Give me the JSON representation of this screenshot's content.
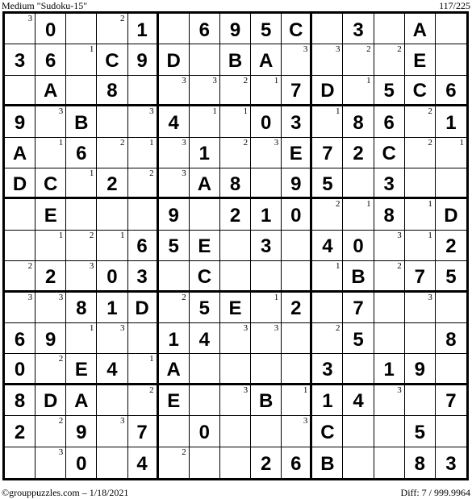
{
  "header": {
    "title": "Medium \"Sudoku-15\"",
    "puzzle_index": "117/225"
  },
  "footer": {
    "credit": "©grouppuzzles.com – 1/18/2021",
    "difficulty": "Diff: 7 / 999.9964"
  },
  "grid": {
    "size": 15,
    "box_cols": 5,
    "box_rows": 3,
    "cells": [
      [
        {
          "h": "3"
        },
        {
          "v": "0"
        },
        {},
        {
          "h": "2"
        },
        {
          "v": "1"
        },
        {},
        {
          "v": "6"
        },
        {
          "v": "9"
        },
        {
          "v": "5"
        },
        {
          "v": "C"
        },
        {},
        {
          "v": "3"
        },
        {},
        {
          "v": "A"
        },
        {}
      ],
      [
        {
          "v": "3"
        },
        {
          "v": "6"
        },
        {
          "h": "1"
        },
        {
          "v": "C"
        },
        {
          "v": "9"
        },
        {
          "v": "D"
        },
        {},
        {
          "v": "B"
        },
        {
          "v": "A"
        },
        {
          "h": "3"
        },
        {
          "h": "3"
        },
        {
          "h": "2"
        },
        {
          "h": "2"
        },
        {
          "v": "E"
        },
        {}
      ],
      [
        {},
        {
          "v": "A"
        },
        {},
        {
          "v": "8"
        },
        {},
        {
          "h": "3"
        },
        {
          "h": "3"
        },
        {
          "h": "2"
        },
        {
          "h": "1"
        },
        {
          "v": "7"
        },
        {
          "v": "D"
        },
        {
          "h": "1"
        },
        {
          "v": "5"
        },
        {
          "v": "C"
        },
        {
          "v": "6"
        }
      ],
      [
        {
          "v": "9"
        },
        {
          "h": "3"
        },
        {
          "v": "B"
        },
        {},
        {
          "h": "3"
        },
        {
          "v": "4"
        },
        {
          "h": "1"
        },
        {
          "h": "1"
        },
        {
          "v": "0"
        },
        {
          "v": "3"
        },
        {
          "h": "1"
        },
        {
          "v": "8"
        },
        {
          "v": "6"
        },
        {
          "h": "2"
        },
        {
          "v": "1"
        }
      ],
      [
        {
          "v": "A"
        },
        {
          "h": "1"
        },
        {
          "v": "6"
        },
        {
          "h": "2"
        },
        {
          "h": "1"
        },
        {
          "h": "3"
        },
        {
          "v": "1"
        },
        {
          "h": "2"
        },
        {
          "h": "3"
        },
        {
          "v": "E"
        },
        {
          "v": "7"
        },
        {
          "v": "2"
        },
        {
          "v": "C"
        },
        {
          "h": "2"
        },
        {
          "h": "1"
        }
      ],
      [
        {
          "v": "D"
        },
        {
          "v": "C"
        },
        {
          "h": "1"
        },
        {
          "v": "2"
        },
        {
          "h": "2"
        },
        {
          "h": "3"
        },
        {
          "v": "A"
        },
        {
          "v": "8"
        },
        {},
        {
          "v": "9"
        },
        {
          "v": "5"
        },
        {},
        {
          "v": "3"
        },
        {},
        {}
      ],
      [
        {},
        {
          "v": "E"
        },
        {},
        {},
        {},
        {
          "v": "9"
        },
        {},
        {
          "v": "2"
        },
        {
          "v": "1"
        },
        {
          "v": "0"
        },
        {
          "h": "2"
        },
        {
          "h": "1"
        },
        {
          "v": "8"
        },
        {
          "h": "1"
        },
        {
          "v": "D"
        }
      ],
      [
        {},
        {
          "h": "1"
        },
        {
          "h": "2"
        },
        {
          "h": "1"
        },
        {
          "v": "6"
        },
        {
          "v": "5"
        },
        {
          "v": "E"
        },
        {},
        {
          "v": "3"
        },
        {},
        {
          "v": "4"
        },
        {
          "v": "0"
        },
        {
          "h": "3"
        },
        {
          "h": "1"
        },
        {
          "v": "2"
        }
      ],
      [
        {
          "h": "2"
        },
        {
          "v": "2"
        },
        {
          "h": "3"
        },
        {
          "v": "0"
        },
        {
          "v": "3"
        },
        {},
        {
          "v": "C"
        },
        {},
        {},
        {},
        {
          "h": "1"
        },
        {
          "v": "B"
        },
        {
          "h": "2"
        },
        {
          "v": "7"
        },
        {
          "v": "5"
        }
      ],
      [
        {
          "h": "3"
        },
        {
          "h": "3"
        },
        {
          "v": "8"
        },
        {
          "v": "1"
        },
        {
          "v": "D"
        },
        {
          "h": "2"
        },
        {
          "v": "5"
        },
        {
          "v": "E"
        },
        {
          "h": "1"
        },
        {
          "v": "2"
        },
        {},
        {
          "v": "7"
        },
        {},
        {
          "h": "3"
        },
        {}
      ],
      [
        {
          "v": "6"
        },
        {
          "v": "9"
        },
        {
          "h": "1"
        },
        {
          "h": "3"
        },
        {},
        {
          "v": "1"
        },
        {
          "v": "4"
        },
        {
          "h": "3"
        },
        {
          "h": "3"
        },
        {},
        {
          "h": "2"
        },
        {
          "v": "5"
        },
        {},
        {},
        {
          "v": "8"
        }
      ],
      [
        {
          "v": "0"
        },
        {
          "h": "2"
        },
        {
          "v": "E"
        },
        {
          "v": "4"
        },
        {
          "h": "1"
        },
        {
          "v": "A"
        },
        {},
        {},
        {},
        {},
        {
          "v": "3"
        },
        {},
        {
          "v": "1"
        },
        {
          "v": "9"
        },
        {}
      ],
      [
        {
          "v": "8"
        },
        {
          "v": "D"
        },
        {
          "v": "A"
        },
        {},
        {
          "h": "2"
        },
        {
          "v": "E"
        },
        {},
        {
          "h": "3"
        },
        {
          "v": "B"
        },
        {
          "h": "1"
        },
        {
          "v": "1"
        },
        {
          "v": "4"
        },
        {
          "h": "3"
        },
        {},
        {
          "v": "7"
        }
      ],
      [
        {
          "v": "2"
        },
        {
          "h": "2"
        },
        {
          "v": "9"
        },
        {
          "h": "3"
        },
        {
          "v": "7"
        },
        {},
        {
          "v": "0"
        },
        {},
        {},
        {
          "h": "3"
        },
        {
          "v": "C"
        },
        {},
        {},
        {
          "v": "5"
        },
        {}
      ],
      [
        {},
        {
          "h": "3"
        },
        {
          "v": "0"
        },
        {},
        {
          "v": "4"
        },
        {
          "h": "2"
        },
        {},
        {},
        {
          "v": "2"
        },
        {
          "v": "6"
        },
        {
          "v": "B"
        },
        {},
        {},
        {
          "v": "8"
        },
        {
          "v": "3"
        }
      ]
    ]
  }
}
